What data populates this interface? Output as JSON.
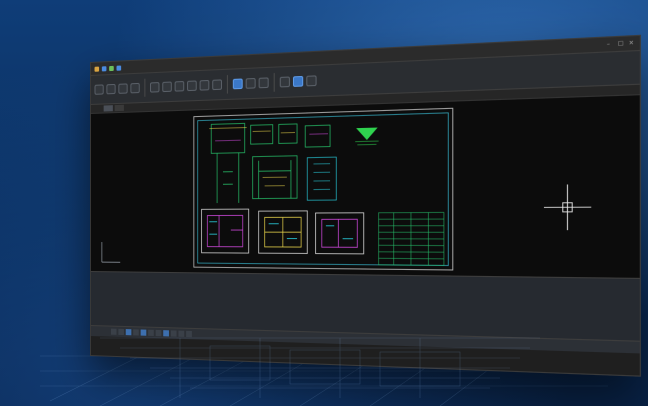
{
  "app": {
    "title": "",
    "tabs": [
      {
        "label": "",
        "active": true
      },
      {
        "label": "",
        "active": false
      }
    ]
  },
  "command_lines": [
    "",
    "",
    ""
  ],
  "status": {
    "coords": "",
    "buttons": [
      "",
      "",
      "",
      "",
      "",
      "",
      "",
      "",
      "",
      "",
      ""
    ]
  },
  "colors": {
    "background": "#0b2f5b",
    "window": "#1f1f1f",
    "canvas": "#0c0c0c",
    "ribbon_accent": "#3b78c8",
    "drawing_green": "#27c06a",
    "drawing_cyan": "#2ad6e6",
    "drawing_yellow": "#e7d34b",
    "drawing_magenta": "#d24ae0"
  }
}
